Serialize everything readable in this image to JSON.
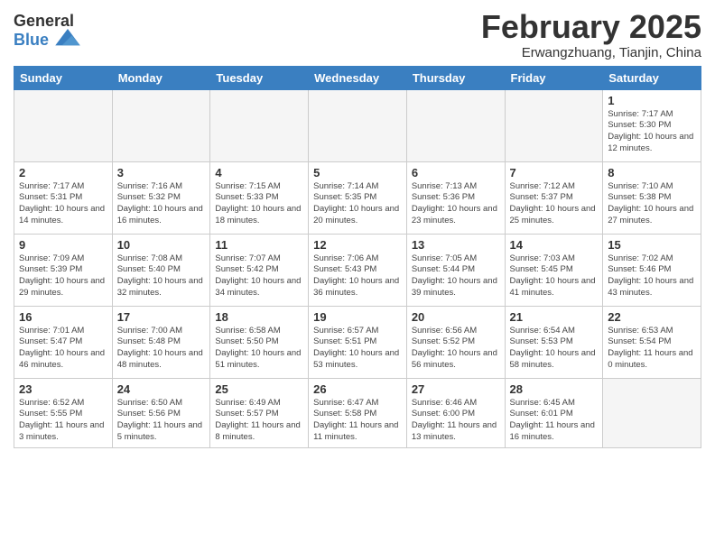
{
  "header": {
    "logo_line1": "General",
    "logo_line2": "Blue",
    "month": "February 2025",
    "location": "Erwangzhuang, Tianjin, China"
  },
  "weekdays": [
    "Sunday",
    "Monday",
    "Tuesday",
    "Wednesday",
    "Thursday",
    "Friday",
    "Saturday"
  ],
  "weeks": [
    [
      {
        "day": "",
        "info": ""
      },
      {
        "day": "",
        "info": ""
      },
      {
        "day": "",
        "info": ""
      },
      {
        "day": "",
        "info": ""
      },
      {
        "day": "",
        "info": ""
      },
      {
        "day": "",
        "info": ""
      },
      {
        "day": "1",
        "info": "Sunrise: 7:17 AM\nSunset: 5:30 PM\nDaylight: 10 hours and 12 minutes."
      }
    ],
    [
      {
        "day": "2",
        "info": "Sunrise: 7:17 AM\nSunset: 5:31 PM\nDaylight: 10 hours and 14 minutes."
      },
      {
        "day": "3",
        "info": "Sunrise: 7:16 AM\nSunset: 5:32 PM\nDaylight: 10 hours and 16 minutes."
      },
      {
        "day": "4",
        "info": "Sunrise: 7:15 AM\nSunset: 5:33 PM\nDaylight: 10 hours and 18 minutes."
      },
      {
        "day": "5",
        "info": "Sunrise: 7:14 AM\nSunset: 5:35 PM\nDaylight: 10 hours and 20 minutes."
      },
      {
        "day": "6",
        "info": "Sunrise: 7:13 AM\nSunset: 5:36 PM\nDaylight: 10 hours and 23 minutes."
      },
      {
        "day": "7",
        "info": "Sunrise: 7:12 AM\nSunset: 5:37 PM\nDaylight: 10 hours and 25 minutes."
      },
      {
        "day": "8",
        "info": "Sunrise: 7:10 AM\nSunset: 5:38 PM\nDaylight: 10 hours and 27 minutes."
      }
    ],
    [
      {
        "day": "9",
        "info": "Sunrise: 7:09 AM\nSunset: 5:39 PM\nDaylight: 10 hours and 29 minutes."
      },
      {
        "day": "10",
        "info": "Sunrise: 7:08 AM\nSunset: 5:40 PM\nDaylight: 10 hours and 32 minutes."
      },
      {
        "day": "11",
        "info": "Sunrise: 7:07 AM\nSunset: 5:42 PM\nDaylight: 10 hours and 34 minutes."
      },
      {
        "day": "12",
        "info": "Sunrise: 7:06 AM\nSunset: 5:43 PM\nDaylight: 10 hours and 36 minutes."
      },
      {
        "day": "13",
        "info": "Sunrise: 7:05 AM\nSunset: 5:44 PM\nDaylight: 10 hours and 39 minutes."
      },
      {
        "day": "14",
        "info": "Sunrise: 7:03 AM\nSunset: 5:45 PM\nDaylight: 10 hours and 41 minutes."
      },
      {
        "day": "15",
        "info": "Sunrise: 7:02 AM\nSunset: 5:46 PM\nDaylight: 10 hours and 43 minutes."
      }
    ],
    [
      {
        "day": "16",
        "info": "Sunrise: 7:01 AM\nSunset: 5:47 PM\nDaylight: 10 hours and 46 minutes."
      },
      {
        "day": "17",
        "info": "Sunrise: 7:00 AM\nSunset: 5:48 PM\nDaylight: 10 hours and 48 minutes."
      },
      {
        "day": "18",
        "info": "Sunrise: 6:58 AM\nSunset: 5:50 PM\nDaylight: 10 hours and 51 minutes."
      },
      {
        "day": "19",
        "info": "Sunrise: 6:57 AM\nSunset: 5:51 PM\nDaylight: 10 hours and 53 minutes."
      },
      {
        "day": "20",
        "info": "Sunrise: 6:56 AM\nSunset: 5:52 PM\nDaylight: 10 hours and 56 minutes."
      },
      {
        "day": "21",
        "info": "Sunrise: 6:54 AM\nSunset: 5:53 PM\nDaylight: 10 hours and 58 minutes."
      },
      {
        "day": "22",
        "info": "Sunrise: 6:53 AM\nSunset: 5:54 PM\nDaylight: 11 hours and 0 minutes."
      }
    ],
    [
      {
        "day": "23",
        "info": "Sunrise: 6:52 AM\nSunset: 5:55 PM\nDaylight: 11 hours and 3 minutes."
      },
      {
        "day": "24",
        "info": "Sunrise: 6:50 AM\nSunset: 5:56 PM\nDaylight: 11 hours and 5 minutes."
      },
      {
        "day": "25",
        "info": "Sunrise: 6:49 AM\nSunset: 5:57 PM\nDaylight: 11 hours and 8 minutes."
      },
      {
        "day": "26",
        "info": "Sunrise: 6:47 AM\nSunset: 5:58 PM\nDaylight: 11 hours and 11 minutes."
      },
      {
        "day": "27",
        "info": "Sunrise: 6:46 AM\nSunset: 6:00 PM\nDaylight: 11 hours and 13 minutes."
      },
      {
        "day": "28",
        "info": "Sunrise: 6:45 AM\nSunset: 6:01 PM\nDaylight: 11 hours and 16 minutes."
      },
      {
        "day": "",
        "info": ""
      }
    ]
  ]
}
